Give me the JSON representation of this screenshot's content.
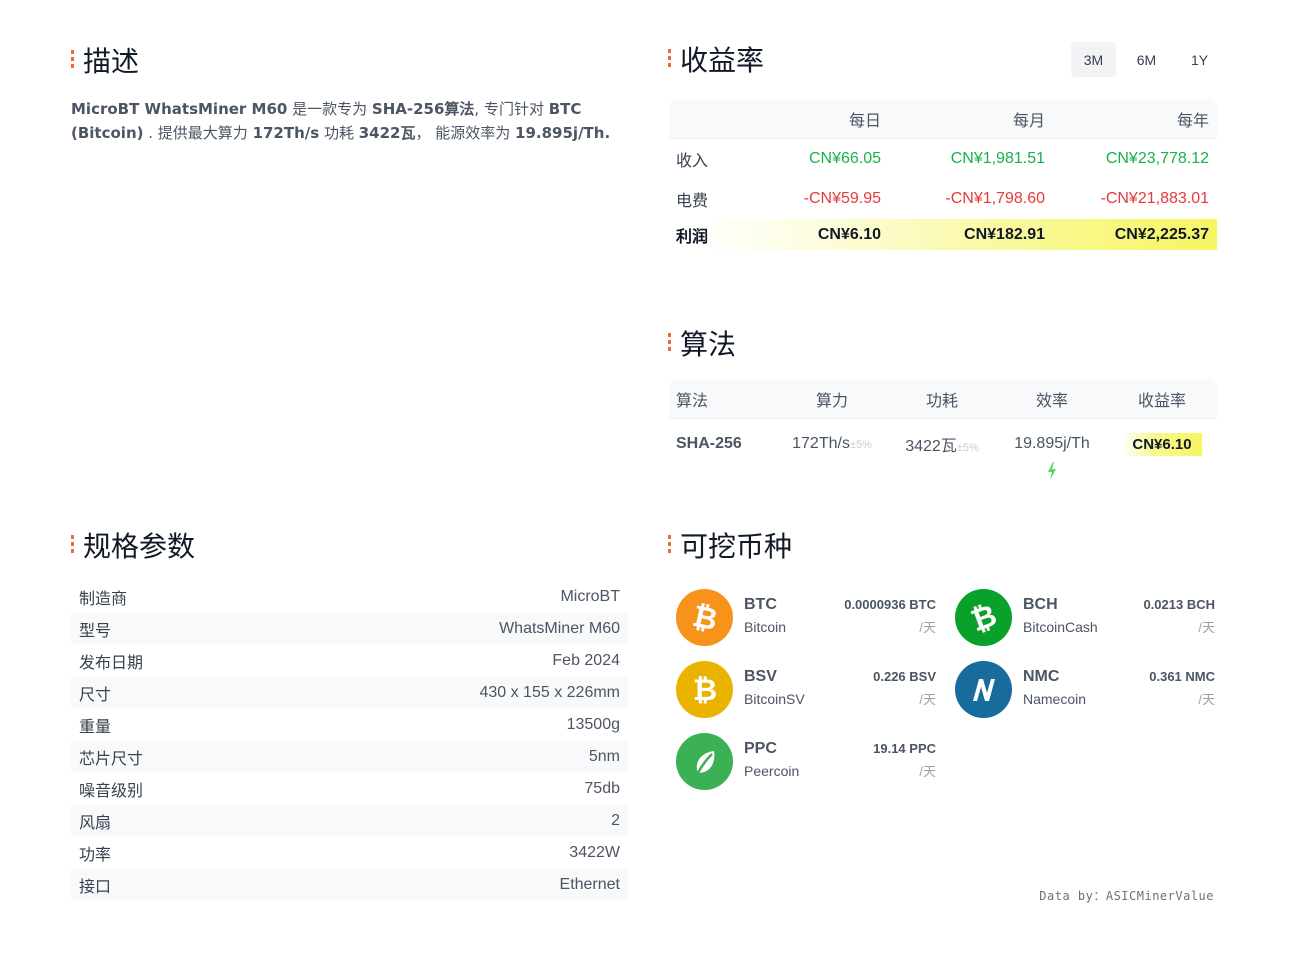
{
  "sections": {
    "description": "描述",
    "profitability": "收益率",
    "algorithm": "算法",
    "specs": "规格参数",
    "coins": "可挖币种"
  },
  "description": {
    "p1": "MicroBT WhatsMiner M60",
    "p2": " 是一款专为 ",
    "p3": "SHA-256算法",
    "p4": ", 专门针对 ",
    "p5": "BTC (Bitcoin)",
    "p6": " . 提供最大算力 ",
    "p7": "172Th/s",
    "p8": " 功耗 ",
    "p9": "3422瓦",
    "p10": "， 能源效率为 ",
    "p11": "19.895j/Th."
  },
  "periods": [
    "3M",
    "6M",
    "1Y"
  ],
  "profit_table": {
    "headers": [
      "",
      "每日",
      "每月",
      "每年"
    ],
    "income": {
      "label": "收入",
      "daily": "CN¥66.05",
      "monthly": "CN¥1,981.51",
      "yearly": "CN¥23,778.12"
    },
    "electricity": {
      "label": "电费",
      "daily": "-CN¥59.95",
      "monthly": "-CN¥1,798.60",
      "yearly": "-CN¥21,883.01"
    },
    "profit": {
      "label": "利润",
      "daily": "CN¥6.10",
      "monthly": "CN¥182.91",
      "yearly": "CN¥2,225.37"
    }
  },
  "algo_table": {
    "headers": [
      "算法",
      "算力",
      "功耗",
      "效率",
      "收益率"
    ],
    "row": {
      "algorithm": "SHA-256",
      "hashrate": "172Th/s",
      "hashrate_tol": "±5%",
      "power": "3422瓦",
      "power_tol": "±5%",
      "efficiency": "19.895j/Th",
      "profit": "CN¥6.10"
    }
  },
  "specs": [
    {
      "k": "制造商",
      "v": "MicroBT"
    },
    {
      "k": "型号",
      "v": "WhatsMiner M60"
    },
    {
      "k": "发布日期",
      "v": "Feb 2024"
    },
    {
      "k": "尺寸",
      "v": "430 x 155 x 226mm"
    },
    {
      "k": "重量",
      "v": "13500g"
    },
    {
      "k": "芯片尺寸",
      "v": "5nm"
    },
    {
      "k": "噪音级别",
      "v": "75db"
    },
    {
      "k": "风扇",
      "v": "2"
    },
    {
      "k": "功率",
      "v": "3422W"
    },
    {
      "k": "接口",
      "v": "Ethernet"
    }
  ],
  "coins": [
    {
      "sym": "BTC",
      "name": "Bitcoin",
      "amount": "0.0000936 BTC",
      "per": "/天",
      "color": "#f7931a",
      "icon": "bitcoin-icon"
    },
    {
      "sym": "BCH",
      "name": "BitcoinCash",
      "amount": "0.0213 BCH",
      "per": "/天",
      "color": "#0ac18e",
      "icon": "bitcoin-cash-icon"
    },
    {
      "sym": "BSV",
      "name": "BitcoinSV",
      "amount": "0.226 BSV",
      "per": "/天",
      "color": "#eab300",
      "icon": "bitcoin-sv-icon"
    },
    {
      "sym": "NMC",
      "name": "Namecoin",
      "amount": "0.361 NMC",
      "per": "/天",
      "color": "#186c9d",
      "icon": "namecoin-icon"
    },
    {
      "sym": "PPC",
      "name": "Peercoin",
      "amount": "19.14 PPC",
      "per": "/天",
      "color": "#3cb054",
      "icon": "peercoin-icon"
    }
  ],
  "footer": "Data by：ASICMinerValue"
}
